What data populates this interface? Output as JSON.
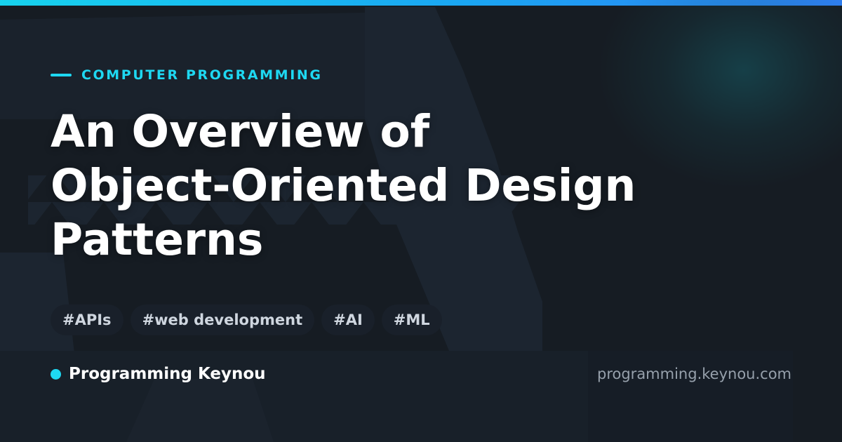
{
  "card": {
    "category": "COMPUTER PROGRAMMING",
    "title_lines": [
      "An Overview of",
      "Object-Oriented Design",
      "Patterns"
    ],
    "tags": [
      "#APIs",
      "#web development",
      "#AI",
      "#ML"
    ],
    "brand": "Programming Keynou",
    "site_url": "programming.keynou.com"
  },
  "colors": {
    "accent": "#1ed8f2",
    "background": "#161c23",
    "title": "#ffffff",
    "tag_background": "#19202a",
    "tag_text": "#cfd6df",
    "url_text": "#96a0ab"
  }
}
